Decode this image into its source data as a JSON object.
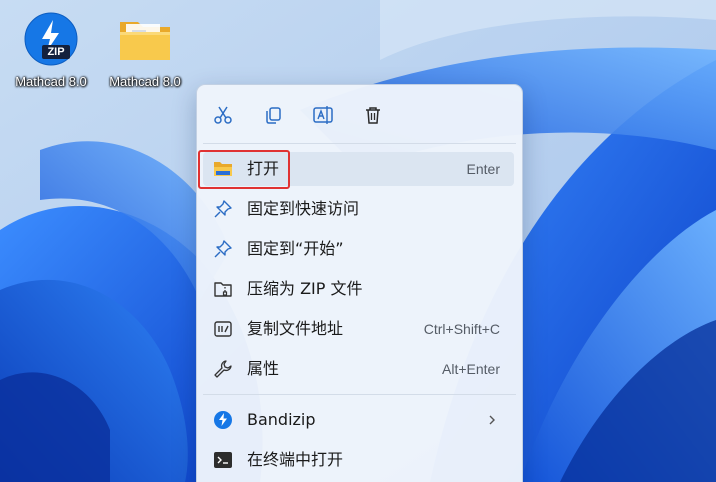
{
  "desktop": {
    "icons": [
      {
        "label": "Mathcad 8.0",
        "kind": "zip-icon",
        "badge_text": "ZIP"
      },
      {
        "label": "Mathcad 8.0",
        "kind": "folder-icon"
      }
    ]
  },
  "context_menu": {
    "toolbar": [
      {
        "name": "cut",
        "icon": "scissors-icon"
      },
      {
        "name": "copy",
        "icon": "copy-icon"
      },
      {
        "name": "rename",
        "icon": "rename-icon"
      },
      {
        "name": "delete",
        "icon": "trash-icon"
      }
    ],
    "items": [
      {
        "label": "打开",
        "shortcut": "Enter",
        "icon": "folder-open-icon",
        "highlighted": true
      },
      {
        "label": "固定到快速访问",
        "shortcut": "",
        "icon": "pin-icon"
      },
      {
        "label": "固定到“开始”",
        "shortcut": "",
        "icon": "pin-start-icon"
      },
      {
        "label": "压缩为 ZIP 文件",
        "shortcut": "",
        "icon": "zip-archive-icon"
      },
      {
        "label": "复制文件地址",
        "shortcut": "Ctrl+Shift+C",
        "icon": "copy-path-icon"
      },
      {
        "label": "属性",
        "shortcut": "Alt+Enter",
        "icon": "wrench-icon"
      },
      {
        "label": "Bandizip",
        "shortcut": "",
        "icon": "bandizip-icon",
        "submenu": true
      },
      {
        "label": "在终端中打开",
        "shortcut": "",
        "icon": "terminal-icon"
      }
    ]
  },
  "colors": {
    "highlight_border": "#e03232",
    "accent_blue": "#1a73e8",
    "folder_yellow": "#f6c443"
  }
}
